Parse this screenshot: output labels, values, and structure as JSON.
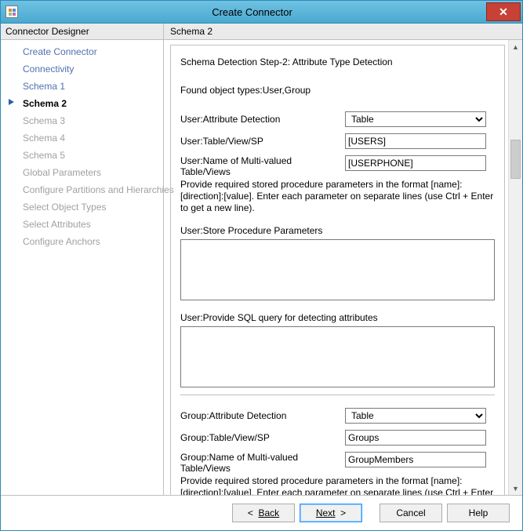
{
  "window": {
    "title": "Create Connector"
  },
  "headers": {
    "left": "Connector Designer",
    "right": "Schema 2"
  },
  "sidebar": {
    "items": [
      {
        "label": "Create Connector",
        "state": "normal"
      },
      {
        "label": "Connectivity",
        "state": "normal"
      },
      {
        "label": "Schema 1",
        "state": "normal"
      },
      {
        "label": "Schema 2",
        "state": "current"
      },
      {
        "label": "Schema 3",
        "state": "disabled"
      },
      {
        "label": "Schema 4",
        "state": "disabled"
      },
      {
        "label": "Schema 5",
        "state": "disabled"
      },
      {
        "label": "Global Parameters",
        "state": "disabled"
      },
      {
        "label": "Configure Partitions and Hierarchies",
        "state": "disabled"
      },
      {
        "label": "Select Object Types",
        "state": "disabled"
      },
      {
        "label": "Select Attributes",
        "state": "disabled"
      },
      {
        "label": "Configure Anchors",
        "state": "disabled"
      }
    ]
  },
  "main": {
    "step_title": "Schema Detection Step-2: Attribute Type Detection",
    "found_types": "Found object types:User,Group",
    "user": {
      "attr_detect_label": "User:Attribute Detection",
      "attr_detect_value": "Table",
      "table_label": "User:Table/View/SP",
      "table_value": "[USERS]",
      "multi_label": "User:Name of Multi-valued Table/Views",
      "multi_value": "[USERPHONE]",
      "hint": "Provide required stored procedure parameters in the format [name]:[direction]:[value]. Enter each parameter on separate lines (use Ctrl + Enter to get a new line).",
      "sp_label": "User:Store Procedure Parameters",
      "sp_value": "",
      "sql_label": "User:Provide SQL query for detecting attributes",
      "sql_value": ""
    },
    "group": {
      "attr_detect_label": "Group:Attribute Detection",
      "attr_detect_value": "Table",
      "table_label": "Group:Table/View/SP",
      "table_value": "Groups",
      "multi_label": "Group:Name of Multi-valued Table/Views",
      "multi_value": "GroupMembers",
      "hint": "Provide required stored procedure parameters in the format [name]:[direction]:[value]. Enter each parameter on separate lines (use Ctrl + Enter to get a new line)."
    }
  },
  "footer": {
    "back": "Back",
    "next": "Next",
    "cancel": "Cancel",
    "help": "Help"
  }
}
